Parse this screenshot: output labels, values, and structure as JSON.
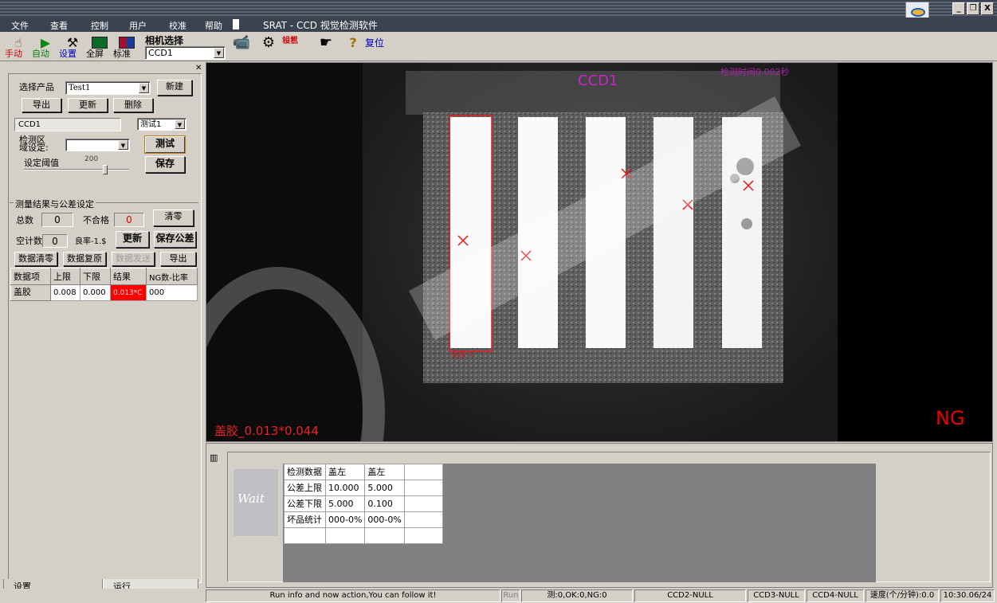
{
  "window": {
    "app_title": "SRAT - CCD 视觉检测软件",
    "buttons": [
      "_",
      "❐",
      "X"
    ]
  },
  "menu": [
    "文件",
    "查看",
    "控制",
    "用户",
    "校准",
    "帮助"
  ],
  "toolbar": {
    "manual": "手动",
    "auto": "自动",
    "settings": "设置",
    "fullscreen": "全屏",
    "calibrate": "标准",
    "camera_select_title": "相机选择",
    "camera_value": "CCD1",
    "camera_setup": "相机\n设置",
    "camera_setup_1": "相机",
    "camera_setup_2": "设置",
    "reset": "复位"
  },
  "left_panel": {
    "select_product_label": "选择产品",
    "product_value": "Test1",
    "new_btn": "新建",
    "export_btn": "导出",
    "update_btn": "更新",
    "delete_btn": "删除",
    "ccd_label": "CCD1",
    "test_combo": "测试1",
    "region_label_1": "检测区",
    "region_label_2": "域设定:",
    "test_btn": "测试",
    "threshold_label": "设定阈值",
    "threshold_value": "200",
    "save_btn": "保存",
    "group_title": "测量结果与公差设定",
    "total_label": "总数",
    "total_value": "0",
    "fail_label": "不合格",
    "fail_value": "0",
    "clear_btn": "清零",
    "empty_count_label": "空计数",
    "empty_count_value": "0",
    "yield_label": "良率-1.$",
    "refresh_btn": "更新",
    "save_tol_btn": "保存公差",
    "data_clear_btn": "数据清零",
    "data_restore_btn": "数据复原",
    "data_send_btn": "数据发送",
    "export2_btn": "导出",
    "table": {
      "headers": [
        "数据项",
        "上限",
        "下限",
        "结果",
        "NG数-比率"
      ],
      "rows": [
        [
          "盖胶",
          "0.008",
          "0.000",
          "0.013*C",
          "000"
        ]
      ]
    },
    "tabs": [
      "设置",
      "运行"
    ]
  },
  "image_view": {
    "camera_label": "CCD1",
    "time_label": "检测时间0.002秒",
    "result_text": "盖胶_0.013*0.044",
    "roi_label": "盖胶 C",
    "verdict": "NG"
  },
  "bottom_pane": {
    "wait": "Wait",
    "table": [
      [
        "检测数据",
        "盖左",
        "盖左",
        ""
      ],
      [
        "公差上限",
        "10.000",
        "5.000",
        ""
      ],
      [
        "公差下限",
        "5.000",
        "0.100",
        ""
      ],
      [
        "坏品统计",
        "000-0%",
        "000-0%",
        ""
      ],
      [
        "",
        "",
        "",
        ""
      ]
    ]
  },
  "status_bar": {
    "info": "Run info and now action,You can follow it!",
    "run": "Run",
    "counts": "测:0,OK:0,NG:0",
    "ccd2": "CCD2-NULL",
    "ccd3": "CCD3-NULL",
    "ccd4": "CCD4-NULL",
    "speed": "速度(个/分钟):0.0",
    "time": "10:30.06/24"
  },
  "colors": {
    "title_bg": "#3c4350",
    "ng_red": "#ff0000",
    "overlay_magenta": "#cc22cc"
  }
}
